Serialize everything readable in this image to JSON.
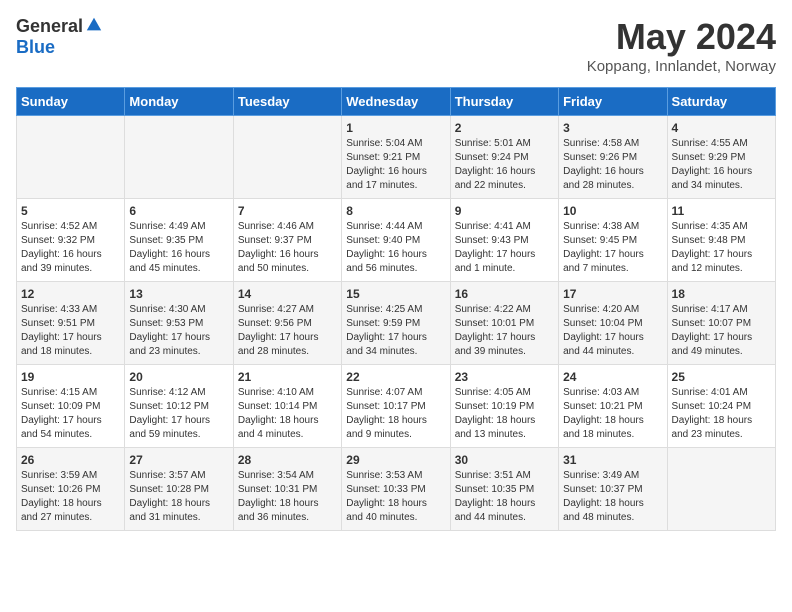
{
  "header": {
    "logo_general": "General",
    "logo_blue": "Blue",
    "title": "May 2024",
    "location": "Koppang, Innlandet, Norway"
  },
  "days_of_week": [
    "Sunday",
    "Monday",
    "Tuesday",
    "Wednesday",
    "Thursday",
    "Friday",
    "Saturday"
  ],
  "weeks": [
    [
      {
        "day": "",
        "info": ""
      },
      {
        "day": "",
        "info": ""
      },
      {
        "day": "",
        "info": ""
      },
      {
        "day": "1",
        "info": "Sunrise: 5:04 AM\nSunset: 9:21 PM\nDaylight: 16 hours\nand 17 minutes."
      },
      {
        "day": "2",
        "info": "Sunrise: 5:01 AM\nSunset: 9:24 PM\nDaylight: 16 hours\nand 22 minutes."
      },
      {
        "day": "3",
        "info": "Sunrise: 4:58 AM\nSunset: 9:26 PM\nDaylight: 16 hours\nand 28 minutes."
      },
      {
        "day": "4",
        "info": "Sunrise: 4:55 AM\nSunset: 9:29 PM\nDaylight: 16 hours\nand 34 minutes."
      }
    ],
    [
      {
        "day": "5",
        "info": "Sunrise: 4:52 AM\nSunset: 9:32 PM\nDaylight: 16 hours\nand 39 minutes."
      },
      {
        "day": "6",
        "info": "Sunrise: 4:49 AM\nSunset: 9:35 PM\nDaylight: 16 hours\nand 45 minutes."
      },
      {
        "day": "7",
        "info": "Sunrise: 4:46 AM\nSunset: 9:37 PM\nDaylight: 16 hours\nand 50 minutes."
      },
      {
        "day": "8",
        "info": "Sunrise: 4:44 AM\nSunset: 9:40 PM\nDaylight: 16 hours\nand 56 minutes."
      },
      {
        "day": "9",
        "info": "Sunrise: 4:41 AM\nSunset: 9:43 PM\nDaylight: 17 hours\nand 1 minute."
      },
      {
        "day": "10",
        "info": "Sunrise: 4:38 AM\nSunset: 9:45 PM\nDaylight: 17 hours\nand 7 minutes."
      },
      {
        "day": "11",
        "info": "Sunrise: 4:35 AM\nSunset: 9:48 PM\nDaylight: 17 hours\nand 12 minutes."
      }
    ],
    [
      {
        "day": "12",
        "info": "Sunrise: 4:33 AM\nSunset: 9:51 PM\nDaylight: 17 hours\nand 18 minutes."
      },
      {
        "day": "13",
        "info": "Sunrise: 4:30 AM\nSunset: 9:53 PM\nDaylight: 17 hours\nand 23 minutes."
      },
      {
        "day": "14",
        "info": "Sunrise: 4:27 AM\nSunset: 9:56 PM\nDaylight: 17 hours\nand 28 minutes."
      },
      {
        "day": "15",
        "info": "Sunrise: 4:25 AM\nSunset: 9:59 PM\nDaylight: 17 hours\nand 34 minutes."
      },
      {
        "day": "16",
        "info": "Sunrise: 4:22 AM\nSunset: 10:01 PM\nDaylight: 17 hours\nand 39 minutes."
      },
      {
        "day": "17",
        "info": "Sunrise: 4:20 AM\nSunset: 10:04 PM\nDaylight: 17 hours\nand 44 minutes."
      },
      {
        "day": "18",
        "info": "Sunrise: 4:17 AM\nSunset: 10:07 PM\nDaylight: 17 hours\nand 49 minutes."
      }
    ],
    [
      {
        "day": "19",
        "info": "Sunrise: 4:15 AM\nSunset: 10:09 PM\nDaylight: 17 hours\nand 54 minutes."
      },
      {
        "day": "20",
        "info": "Sunrise: 4:12 AM\nSunset: 10:12 PM\nDaylight: 17 hours\nand 59 minutes."
      },
      {
        "day": "21",
        "info": "Sunrise: 4:10 AM\nSunset: 10:14 PM\nDaylight: 18 hours\nand 4 minutes."
      },
      {
        "day": "22",
        "info": "Sunrise: 4:07 AM\nSunset: 10:17 PM\nDaylight: 18 hours\nand 9 minutes."
      },
      {
        "day": "23",
        "info": "Sunrise: 4:05 AM\nSunset: 10:19 PM\nDaylight: 18 hours\nand 13 minutes."
      },
      {
        "day": "24",
        "info": "Sunrise: 4:03 AM\nSunset: 10:21 PM\nDaylight: 18 hours\nand 18 minutes."
      },
      {
        "day": "25",
        "info": "Sunrise: 4:01 AM\nSunset: 10:24 PM\nDaylight: 18 hours\nand 23 minutes."
      }
    ],
    [
      {
        "day": "26",
        "info": "Sunrise: 3:59 AM\nSunset: 10:26 PM\nDaylight: 18 hours\nand 27 minutes."
      },
      {
        "day": "27",
        "info": "Sunrise: 3:57 AM\nSunset: 10:28 PM\nDaylight: 18 hours\nand 31 minutes."
      },
      {
        "day": "28",
        "info": "Sunrise: 3:54 AM\nSunset: 10:31 PM\nDaylight: 18 hours\nand 36 minutes."
      },
      {
        "day": "29",
        "info": "Sunrise: 3:53 AM\nSunset: 10:33 PM\nDaylight: 18 hours\nand 40 minutes."
      },
      {
        "day": "30",
        "info": "Sunrise: 3:51 AM\nSunset: 10:35 PM\nDaylight: 18 hours\nand 44 minutes."
      },
      {
        "day": "31",
        "info": "Sunrise: 3:49 AM\nSunset: 10:37 PM\nDaylight: 18 hours\nand 48 minutes."
      },
      {
        "day": "",
        "info": ""
      }
    ]
  ]
}
